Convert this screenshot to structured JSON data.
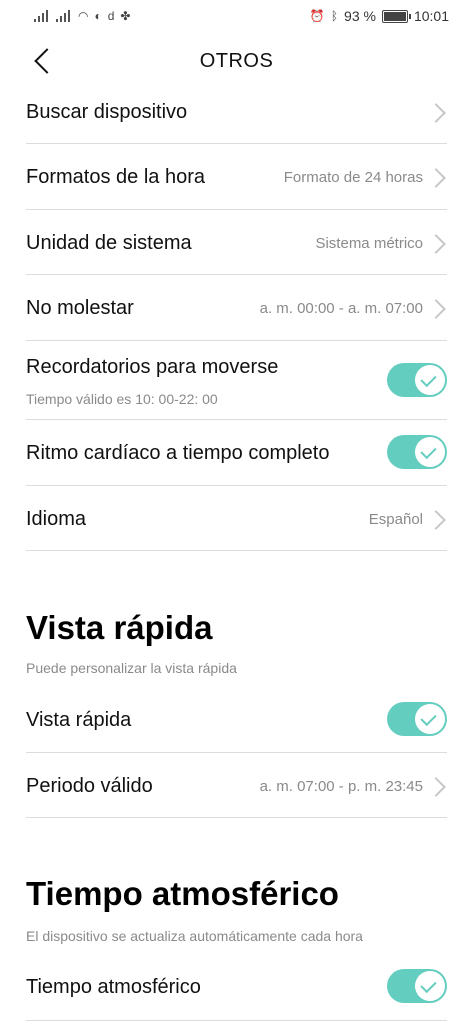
{
  "status_bar": {
    "battery_percent": "93 %",
    "time": "10:01",
    "icons": [
      "signal-icon",
      "signal-icon",
      "wifi-icon",
      "sync-icon",
      "d-icon",
      "fan-icon",
      "alarm-icon",
      "bluetooth-icon",
      "battery-icon"
    ]
  },
  "header": {
    "title": "OTROS"
  },
  "settings": {
    "buscar": {
      "label": "Buscar dispositivo"
    },
    "formatos": {
      "label": "Formatos de la hora",
      "value": "Formato de 24 horas"
    },
    "unidad": {
      "label": "Unidad de sistema",
      "value": "Sistema métrico"
    },
    "molestar": {
      "label": "No molestar",
      "value": "a. m. 00:00 - a. m. 07:00"
    },
    "recordatorios": {
      "label": "Recordatorios para moverse",
      "sub": "Tiempo válido es 10: 00-22: 00",
      "enabled": true
    },
    "ritmo": {
      "label": "Ritmo cardíaco a tiempo completo",
      "enabled": true
    },
    "idioma": {
      "label": "Idioma",
      "value": "Español"
    }
  },
  "vista": {
    "title": "Vista rápida",
    "desc": "Puede personalizar la vista rápida",
    "toggle_row": {
      "label": "Vista rápida",
      "enabled": true
    },
    "periodo": {
      "label": "Periodo válido",
      "value": "a. m. 07:00 - p. m. 23:45"
    }
  },
  "tiempo": {
    "title": "Tiempo atmosférico",
    "desc": "El dispositivo se actualiza automáticamente cada hora",
    "toggle_row": {
      "label": "Tiempo atmosférico",
      "enabled": true
    }
  },
  "colors": {
    "accent": "#63cdbf",
    "divider": "#dcdcdc",
    "secondary_text": "#8a8a8a"
  }
}
